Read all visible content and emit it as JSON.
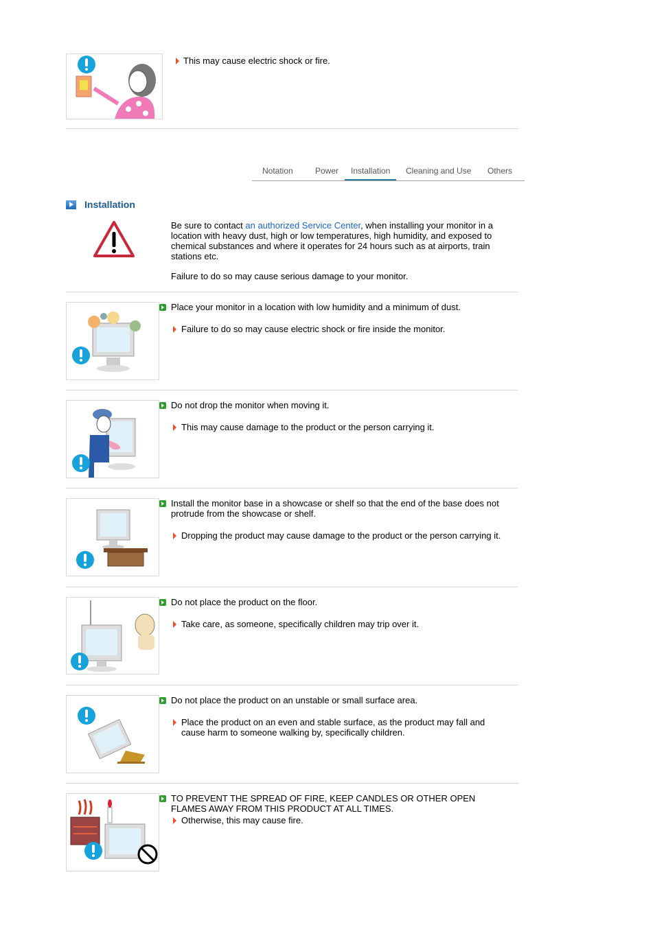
{
  "top_item": {
    "note": "This may cause electric shock or fire."
  },
  "tabs": [
    {
      "label": "Notation",
      "active": false
    },
    {
      "label": "Power",
      "active": false
    },
    {
      "label": "Installation",
      "active": true
    },
    {
      "label": "Cleaning and Use",
      "active": false
    },
    {
      "label": "Others",
      "active": false
    }
  ],
  "section": {
    "title": "Installation",
    "intro_prefix": "Be sure to contact ",
    "intro_link": "an authorized Service Center",
    "intro_suffix": ", when installing your monitor in a location with heavy dust, high or low temperatures, high humidity, and exposed to chemical substances and where it operates for 24 hours such as at airports, train stations etc.",
    "intro_warning": "Failure to do so may cause serious damage to your monitor."
  },
  "items": [
    {
      "main": "Place your monitor in a location with low humidity and a minimum of dust.",
      "note": "Failure to do so may cause electric shock or fire inside the monitor.",
      "illustration": "dusty-monitor-illustration"
    },
    {
      "main": "Do not drop the monitor when moving it.",
      "note": "This may cause damage to the product or the person carrying it.",
      "illustration": "person-carrying-monitor-illustration"
    },
    {
      "main": "Install the monitor base in a showcase or shelf so that the end of the base does not protrude from the showcase or shelf.",
      "note": "Dropping the product may cause damage to the product or the person carrying it.",
      "illustration": "monitor-on-shelf-illustration"
    },
    {
      "main": "Do not place the product on the floor.",
      "note": "Take care, as someone, specifically children may trip over it.",
      "illustration": "monitor-on-floor-child-illustration"
    },
    {
      "main": "Do not place the product on an unstable or small surface area.",
      "note": "Place the product on an even and stable surface, as the product may fall and cause harm to someone walking by, specifically children.",
      "illustration": "falling-monitor-illustration"
    },
    {
      "main": "TO PREVENT THE SPREAD OF FIRE, KEEP CANDLES OR OTHER OPEN FLAMES AWAY FROM THIS PRODUCT AT ALL TIMES.",
      "note": "Otherwise, this may cause fire.",
      "illustration": "candle-heater-monitor-illustration"
    }
  ],
  "colors": {
    "heading": "#1d5a92",
    "link": "#1a66cc",
    "arrow": "#e8522a",
    "bullet": "#2e9c2e",
    "tab_active": "#2a7fa8"
  }
}
